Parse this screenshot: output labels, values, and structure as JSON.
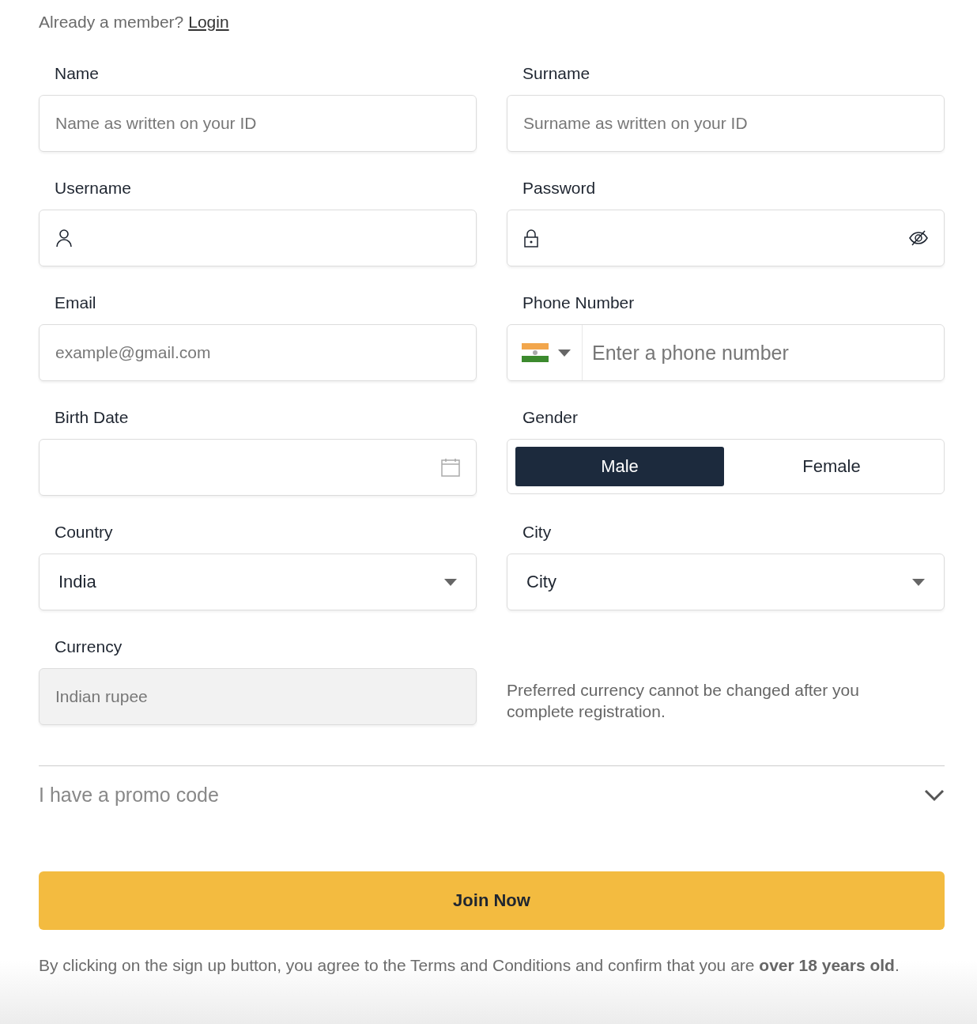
{
  "login_prompt": {
    "text": "Already a member?",
    "link": "Login"
  },
  "fields": [
    {
      "kind": "text",
      "label": "Name",
      "placeholder": "Name as written on your ID"
    },
    {
      "kind": "text",
      "label": "Surname",
      "placeholder": "Surname as written on your ID"
    },
    {
      "kind": "username",
      "label": "Username"
    },
    {
      "kind": "password",
      "label": "Password"
    },
    {
      "kind": "text",
      "label": "Email",
      "placeholder": "example@gmail.com"
    },
    {
      "kind": "phone",
      "label": "Phone Number",
      "placeholder": "Enter a phone number"
    },
    {
      "kind": "date",
      "label": "Birth Date"
    },
    {
      "kind": "toggle",
      "label": "Gender",
      "options": [
        {
          "label": "Male",
          "selected": true
        },
        {
          "label": "Female",
          "selected": false
        }
      ]
    },
    {
      "kind": "select",
      "label": "Country",
      "value": "India"
    },
    {
      "kind": "select",
      "label": "City",
      "value": "City"
    },
    {
      "kind": "readonly",
      "label": "Currency",
      "value": "Indian rupee"
    },
    {
      "kind": "note",
      "text": "Preferred currency cannot be changed after you complete registration."
    }
  ],
  "promo": {
    "label": "I have a promo code",
    "expanded": false
  },
  "submit": "Join Now",
  "disclaimer": "By clicking on the sign up button, you agree to the Terms and Conditions and confirm that you are **over 18 years old**."
}
